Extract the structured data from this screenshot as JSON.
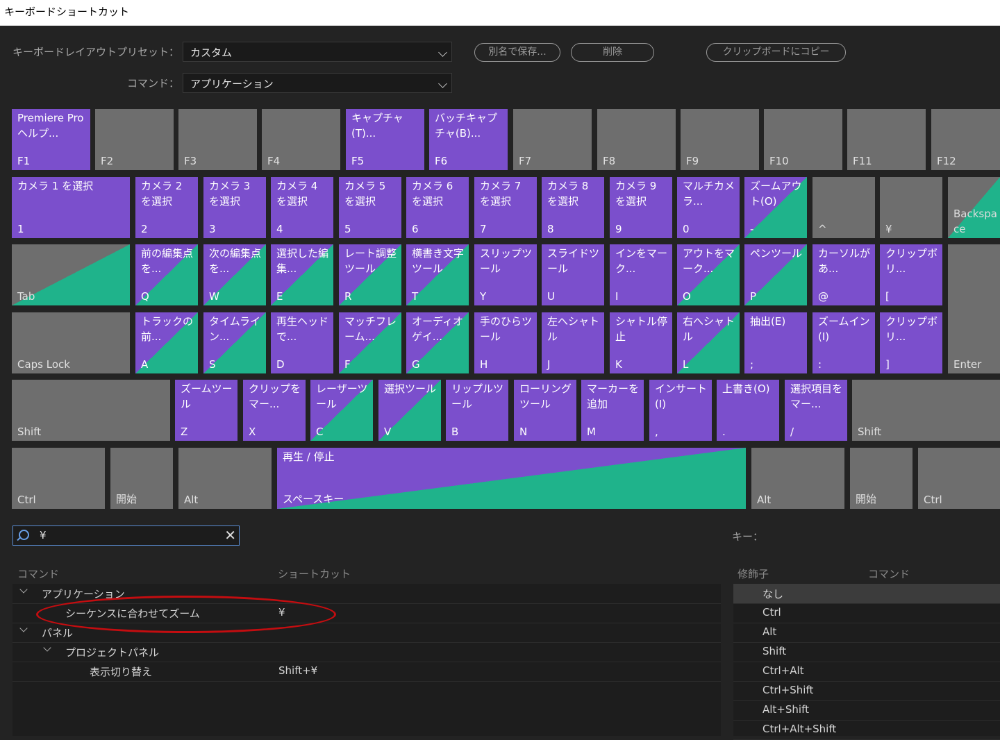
{
  "window": {
    "title": "キーボードショートカット"
  },
  "toolbar": {
    "preset_label": "キーボードレイアウトプリセット：",
    "preset_value": "カスタム",
    "command_label": "コマンド：",
    "command_value": "アプリケーション",
    "save_as": "別名で保存...",
    "delete": "削除",
    "copy_clipboard": "クリップボードにコピー"
  },
  "keys": {
    "F1": {
      "cmd": "Premiere Pro ヘルプ...",
      "label": "F1"
    },
    "F2": {
      "label": "F2"
    },
    "F3": {
      "label": "F3"
    },
    "F4": {
      "label": "F4"
    },
    "F5": {
      "cmd": "キャプチャ (T)...",
      "label": "F5"
    },
    "F6": {
      "cmd": "バッチキャプチャ(B)...",
      "label": "F6"
    },
    "F7": {
      "label": "F7"
    },
    "F8": {
      "label": "F8"
    },
    "F9": {
      "label": "F9"
    },
    "F10": {
      "label": "F10"
    },
    "F11": {
      "label": "F11"
    },
    "F12": {
      "label": "F12"
    },
    "n1": {
      "cmd": "カメラ 1 を選択",
      "label": "1"
    },
    "n2": {
      "cmd": "カメラ 2 を選択",
      "label": "2"
    },
    "n3": {
      "cmd": "カメラ 3 を選択",
      "label": "3"
    },
    "n4": {
      "cmd": "カメラ 4 を選択",
      "label": "4"
    },
    "n5": {
      "cmd": "カメラ 5 を選択",
      "label": "5"
    },
    "n6": {
      "cmd": "カメラ 6 を選択",
      "label": "6"
    },
    "n7": {
      "cmd": "カメラ 7 を選択",
      "label": "7"
    },
    "n8": {
      "cmd": "カメラ 8 を選択",
      "label": "8"
    },
    "n9": {
      "cmd": "カメラ 9 を選択",
      "label": "9"
    },
    "n0": {
      "cmd": "マルチカメラ...",
      "label": "0"
    },
    "minus": {
      "cmd": "ズームアウト(O)",
      "label": "-"
    },
    "caret": {
      "label": "^"
    },
    "yen": {
      "label": "¥"
    },
    "backspace": {
      "label": "Backspace"
    },
    "tab": {
      "label": "Tab"
    },
    "Q": {
      "cmd": "前の編集点を...",
      "label": "Q"
    },
    "W": {
      "cmd": "次の編集点を...",
      "label": "W"
    },
    "E": {
      "cmd": "選択した編集...",
      "label": "E"
    },
    "R": {
      "cmd": "レート調整ツール",
      "label": "R"
    },
    "T": {
      "cmd": "横書き文字ツール",
      "label": "T"
    },
    "Y": {
      "cmd": "スリップツール",
      "label": "Y"
    },
    "U": {
      "cmd": "スライドツール",
      "label": "U"
    },
    "I": {
      "cmd": "インをマーク...",
      "label": "I"
    },
    "O": {
      "cmd": "アウトをマーク...",
      "label": "O"
    },
    "P": {
      "cmd": "ペンツール",
      "label": "P"
    },
    "at": {
      "cmd": "カーソルがあ...",
      "label": "@"
    },
    "lbracket": {
      "cmd": "クリップボリ...",
      "label": "["
    },
    "caps": {
      "label": "Caps Lock"
    },
    "A": {
      "cmd": "トラックの前...",
      "label": "A"
    },
    "S": {
      "cmd": "タイムライン...",
      "label": "S"
    },
    "D": {
      "cmd": "再生ヘッドで...",
      "label": "D"
    },
    "F": {
      "cmd": "マッチフレーム...",
      "label": "F"
    },
    "G": {
      "cmd": "オーディオゲイ...",
      "label": "G"
    },
    "H": {
      "cmd": "手のひらツール",
      "label": "H"
    },
    "J": {
      "cmd": "左へシャトル",
      "label": "J"
    },
    "K": {
      "cmd": "シャトル停止",
      "label": "K"
    },
    "L": {
      "cmd": "右へシャトル",
      "label": "L"
    },
    "semicolon": {
      "cmd": "抽出(E)",
      "label": ";"
    },
    "colon": {
      "cmd": "ズームイン(I)",
      "label": ":"
    },
    "rbracket": {
      "cmd": "クリップボリ...",
      "label": "]"
    },
    "enter": {
      "label": "Enter"
    },
    "lshift": {
      "label": "Shift"
    },
    "Z": {
      "cmd": "ズームツール",
      "label": "Z"
    },
    "X": {
      "cmd": "クリップをマー...",
      "label": "X"
    },
    "C": {
      "cmd": "レーザーツール",
      "label": "C"
    },
    "V": {
      "cmd": "選択ツール",
      "label": "V"
    },
    "B": {
      "cmd": "リップルツール",
      "label": "B"
    },
    "N": {
      "cmd": "ローリングツール",
      "label": "N"
    },
    "M": {
      "cmd": "マーカーを追加",
      "label": "M"
    },
    "comma": {
      "cmd": "インサート(I)",
      "label": ","
    },
    "period": {
      "cmd": "上書き(O)",
      "label": "."
    },
    "slash": {
      "cmd": "選択項目をマー...",
      "label": "/"
    },
    "rshift": {
      "label": "Shift"
    },
    "lctrl": {
      "label": "Ctrl"
    },
    "lwin": {
      "label": "開始"
    },
    "lalt": {
      "label": "Alt"
    },
    "space": {
      "cmd": "再生 / 停止",
      "label": "スペースキー"
    },
    "ralt": {
      "label": "Alt"
    },
    "rwin": {
      "label": "開始"
    },
    "rctrl": {
      "label": "Ctrl"
    }
  },
  "search": {
    "value": "¥"
  },
  "key_info": {
    "label": "キー："
  },
  "table": {
    "col_command": "コマンド",
    "col_shortcut": "ショートカット",
    "rows": [
      {
        "name": "アプリケーション",
        "shortcut": ""
      },
      {
        "name": "シーケンスに合わせてズーム",
        "shortcut": "¥"
      },
      {
        "name": "パネル",
        "shortcut": ""
      },
      {
        "name": "プロジェクトパネル",
        "shortcut": ""
      },
      {
        "name": "表示切り替え",
        "shortcut": "Shift+¥"
      }
    ]
  },
  "modifiers": {
    "col_modifier": "修飾子",
    "col_command": "コマンド",
    "items": [
      "なし",
      "Ctrl",
      "Alt",
      "Shift",
      "Ctrl+Alt",
      "Ctrl+Shift",
      "Alt+Shift",
      "Ctrl+Alt+Shift"
    ]
  },
  "colors": {
    "purple": "#7b4fcc",
    "green": "#1fb38b",
    "gray_key": "#6e6e6e",
    "highlight_ring": "#c40d10"
  }
}
